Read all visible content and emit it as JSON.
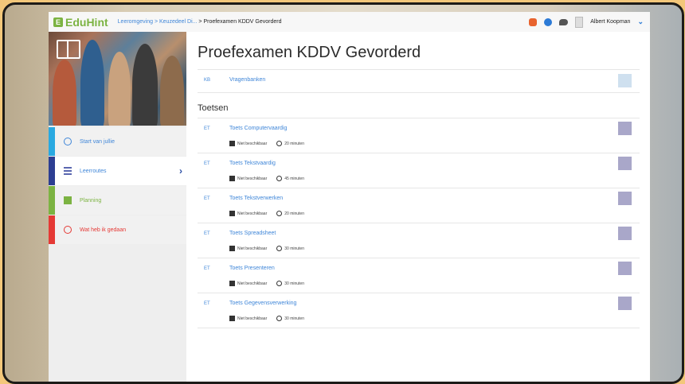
{
  "header": {
    "logo_mark": "E",
    "logo_text": "EduHint",
    "breadcrumb_link": "Leeromgeving > Keuzedeel Di...",
    "breadcrumb_current": " > Proefexamen KDDV Gevorderd",
    "user_name": "Albert Koopman"
  },
  "sidebar": {
    "items": [
      {
        "label": "Start van jullie",
        "color": "#29a9e1",
        "icon": "circle-check-icon"
      },
      {
        "label": "Leerroutes",
        "color": "#2c3e92",
        "icon": "list-icon"
      },
      {
        "label": "Planning",
        "color": "#7cb342",
        "icon": "flag-icon"
      },
      {
        "label": "Wat heb ik gedaan",
        "color": "#e53935",
        "icon": "alert-circle-icon"
      }
    ],
    "active_arrow": "›"
  },
  "main": {
    "title": "Proefexamen KDDV Gevorderd",
    "intro": {
      "code": "KB",
      "label": "Vragenbanken"
    },
    "section_title": "Toetsen",
    "tests": [
      {
        "code": "ET",
        "label": "Toets Computervaardig",
        "availability": "Niet beschikbaar",
        "duration": "20 minuten"
      },
      {
        "code": "ET",
        "label": "Toets Tekstvaardig",
        "availability": "Niet beschikbaar",
        "duration": "45 minuten"
      },
      {
        "code": "ET",
        "label": "Toets Tekstverwerken",
        "availability": "Niet beschikbaar",
        "duration": "20 minuten"
      },
      {
        "code": "ET",
        "label": "Toets Spreadsheet",
        "availability": "Niet beschikbaar",
        "duration": "30 minuten"
      },
      {
        "code": "ET",
        "label": "Toets Presenteren",
        "availability": "Niet beschikbaar",
        "duration": "30 minuten"
      },
      {
        "code": "ET",
        "label": "Toets Gegevensverwerking",
        "availability": "Niet beschikbaar",
        "duration": "30 minuten"
      }
    ]
  },
  "colors": {
    "accent": "#3f86d8",
    "action_square": "#a9a7c9"
  }
}
